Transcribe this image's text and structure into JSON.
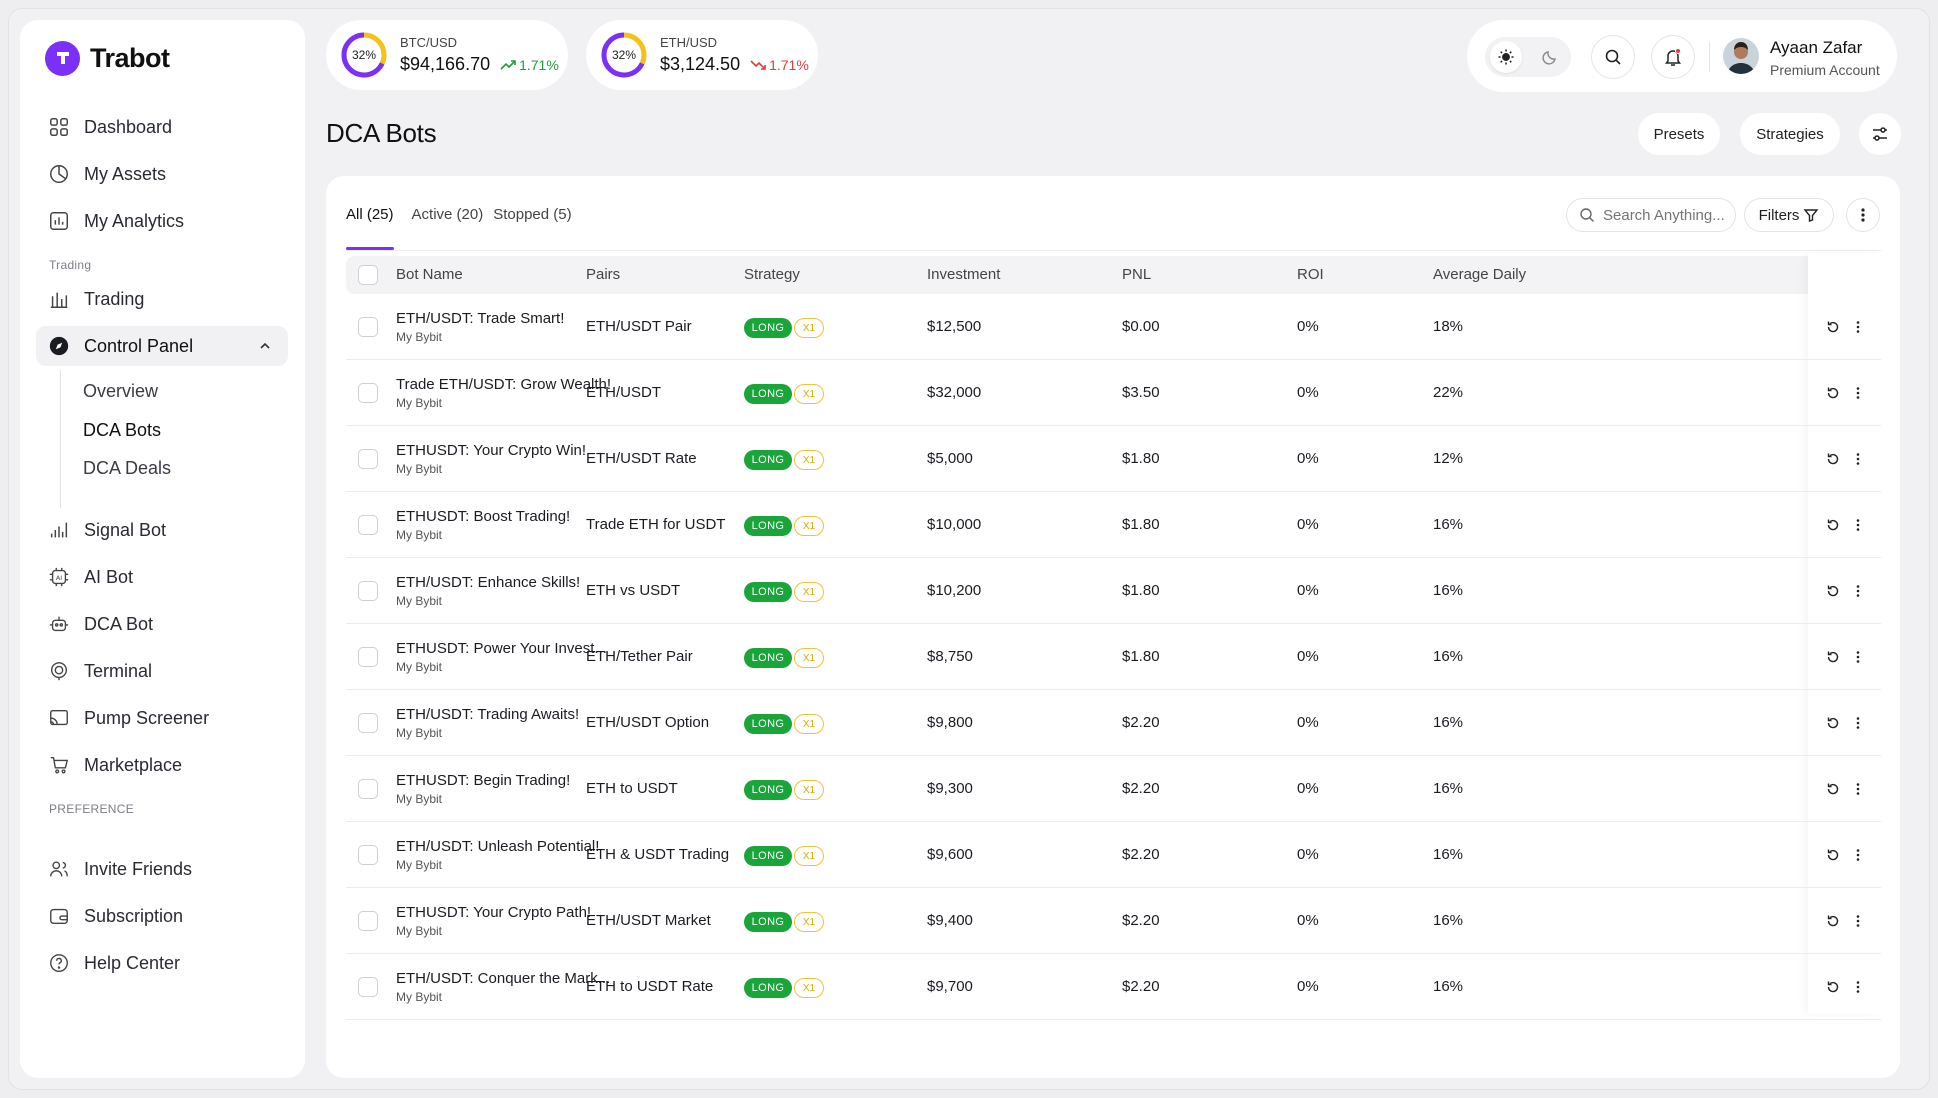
{
  "brand": {
    "name": "Trabot"
  },
  "sidebar": {
    "main_items": [
      {
        "label": "Dashboard",
        "icon": "grid-icon"
      },
      {
        "label": "My Assets",
        "icon": "pie-icon"
      },
      {
        "label": "My Analytics",
        "icon": "bar-chart-icon"
      }
    ],
    "section_trading": "Trading",
    "trading_item": {
      "label": "Trading",
      "icon": "trading-icon"
    },
    "control_panel": {
      "label": "Control Panel",
      "icon": "compass-icon"
    },
    "sub_items": [
      "Overview",
      "DCA Bots",
      "DCA Deals"
    ],
    "bot_items": [
      {
        "label": "Signal Bot",
        "icon": "signal-icon"
      },
      {
        "label": "AI Bot",
        "icon": "ai-chip-icon"
      },
      {
        "label": "DCA Bot",
        "icon": "robot-icon"
      },
      {
        "label": "Terminal",
        "icon": "terminal-icon"
      },
      {
        "label": "Pump Screener",
        "icon": "cast-icon"
      },
      {
        "label": "Marketplace",
        "icon": "cart-icon"
      }
    ],
    "section_preference": "PREFERENCE",
    "pref_items": [
      {
        "label": "Invite Friends",
        "icon": "users-icon"
      },
      {
        "label": "Subscription",
        "icon": "wallet-icon"
      },
      {
        "label": "Help Center",
        "icon": "help-icon"
      }
    ]
  },
  "tickers": [
    {
      "pair": "BTC/USD",
      "price": "$94,166.70",
      "change": "1.71%",
      "direction": "up",
      "ring": "32%",
      "ring_value": 0.32
    },
    {
      "pair": "ETH/USD",
      "price": "$3,124.50",
      "change": "1.71%",
      "direction": "down",
      "ring": "32%",
      "ring_value": 0.32
    }
  ],
  "user": {
    "name": "Ayaan Zafar",
    "role": "Premium Account"
  },
  "page": {
    "title": "DCA Bots",
    "presets_label": "Presets",
    "strategies_label": "Strategies"
  },
  "tabs": [
    {
      "label": "All (25)",
      "active": true
    },
    {
      "label": "Active (20)",
      "active": false
    },
    {
      "label": "Stopped (5)",
      "active": false
    }
  ],
  "search": {
    "placeholder": "Search Anything..."
  },
  "filters_label": "Filters",
  "table": {
    "columns": [
      "Bot Name",
      "Pairs",
      "Strategy",
      "Investment",
      "PNL",
      "ROI",
      "Average Daily"
    ],
    "rows": [
      {
        "name": "ETH/USDT: Trade Smart!",
        "exchange": "My Bybit",
        "pair": "ETH/USDT Pair",
        "strategy": "LONG",
        "leverage": "X1",
        "investment": "$12,500",
        "pnl": "$0.00",
        "roi": "0%",
        "avg_daily": "18%"
      },
      {
        "name": "Trade ETH/USDT: Grow Wealth!",
        "exchange": "My Bybit",
        "pair": "ETH/USDT",
        "strategy": "LONG",
        "leverage": "X1",
        "investment": "$32,000",
        "pnl": "$3.50",
        "roi": "0%",
        "avg_daily": "22%"
      },
      {
        "name": "ETHUSDT: Your Crypto Win!",
        "exchange": "My Bybit",
        "pair": "ETH/USDT Rate",
        "strategy": "LONG",
        "leverage": "X1",
        "investment": "$5,000",
        "pnl": "$1.80",
        "roi": "0%",
        "avg_daily": "12%"
      },
      {
        "name": "ETHUSDT: Boost Trading!",
        "exchange": "My Bybit",
        "pair": "Trade ETH for USDT",
        "strategy": "LONG",
        "leverage": "X1",
        "investment": "$10,000",
        "pnl": "$1.80",
        "roi": "0%",
        "avg_daily": "16%"
      },
      {
        "name": "ETH/USDT: Enhance Skills!",
        "exchange": "My Bybit",
        "pair": "ETH vs USDT",
        "strategy": "LONG",
        "leverage": "X1",
        "investment": "$10,200",
        "pnl": "$1.80",
        "roi": "0%",
        "avg_daily": "16%"
      },
      {
        "name": "ETHUSDT: Power Your Invest...",
        "exchange": "My Bybit",
        "pair": "ETH/Tether Pair",
        "strategy": "LONG",
        "leverage": "X1",
        "investment": "$8,750",
        "pnl": "$1.80",
        "roi": "0%",
        "avg_daily": "16%"
      },
      {
        "name": "ETH/USDT: Trading Awaits!",
        "exchange": "My Bybit",
        "pair": "ETH/USDT Option",
        "strategy": "LONG",
        "leverage": "X1",
        "investment": "$9,800",
        "pnl": "$2.20",
        "roi": "0%",
        "avg_daily": "16%"
      },
      {
        "name": "ETHUSDT: Begin Trading!",
        "exchange": "My Bybit",
        "pair": "ETH to USDT",
        "strategy": "LONG",
        "leverage": "X1",
        "investment": "$9,300",
        "pnl": "$2.20",
        "roi": "0%",
        "avg_daily": "16%"
      },
      {
        "name": "ETH/USDT: Unleash Potential!",
        "exchange": "My Bybit",
        "pair": "ETH & USDT Trading",
        "strategy": "LONG",
        "leverage": "X1",
        "investment": "$9,600",
        "pnl": "$2.20",
        "roi": "0%",
        "avg_daily": "16%"
      },
      {
        "name": "ETHUSDT: Your Crypto Path!",
        "exchange": "My Bybit",
        "pair": "ETH/USDT Market",
        "strategy": "LONG",
        "leverage": "X1",
        "investment": "$9,400",
        "pnl": "$2.20",
        "roi": "0%",
        "avg_daily": "16%"
      },
      {
        "name": "ETH/USDT: Conquer the Mark...",
        "exchange": "My Bybit",
        "pair": "ETH to USDT Rate",
        "strategy": "LONG",
        "leverage": "X1",
        "investment": "$9,700",
        "pnl": "$2.20",
        "roi": "0%",
        "avg_daily": "16%"
      }
    ]
  },
  "colors": {
    "accent": "#7b2ff7",
    "long_badge": "#1aa53a",
    "leverage_badge": "#f0c33a",
    "up": "#1f9d3a",
    "down": "#e23b3b"
  }
}
